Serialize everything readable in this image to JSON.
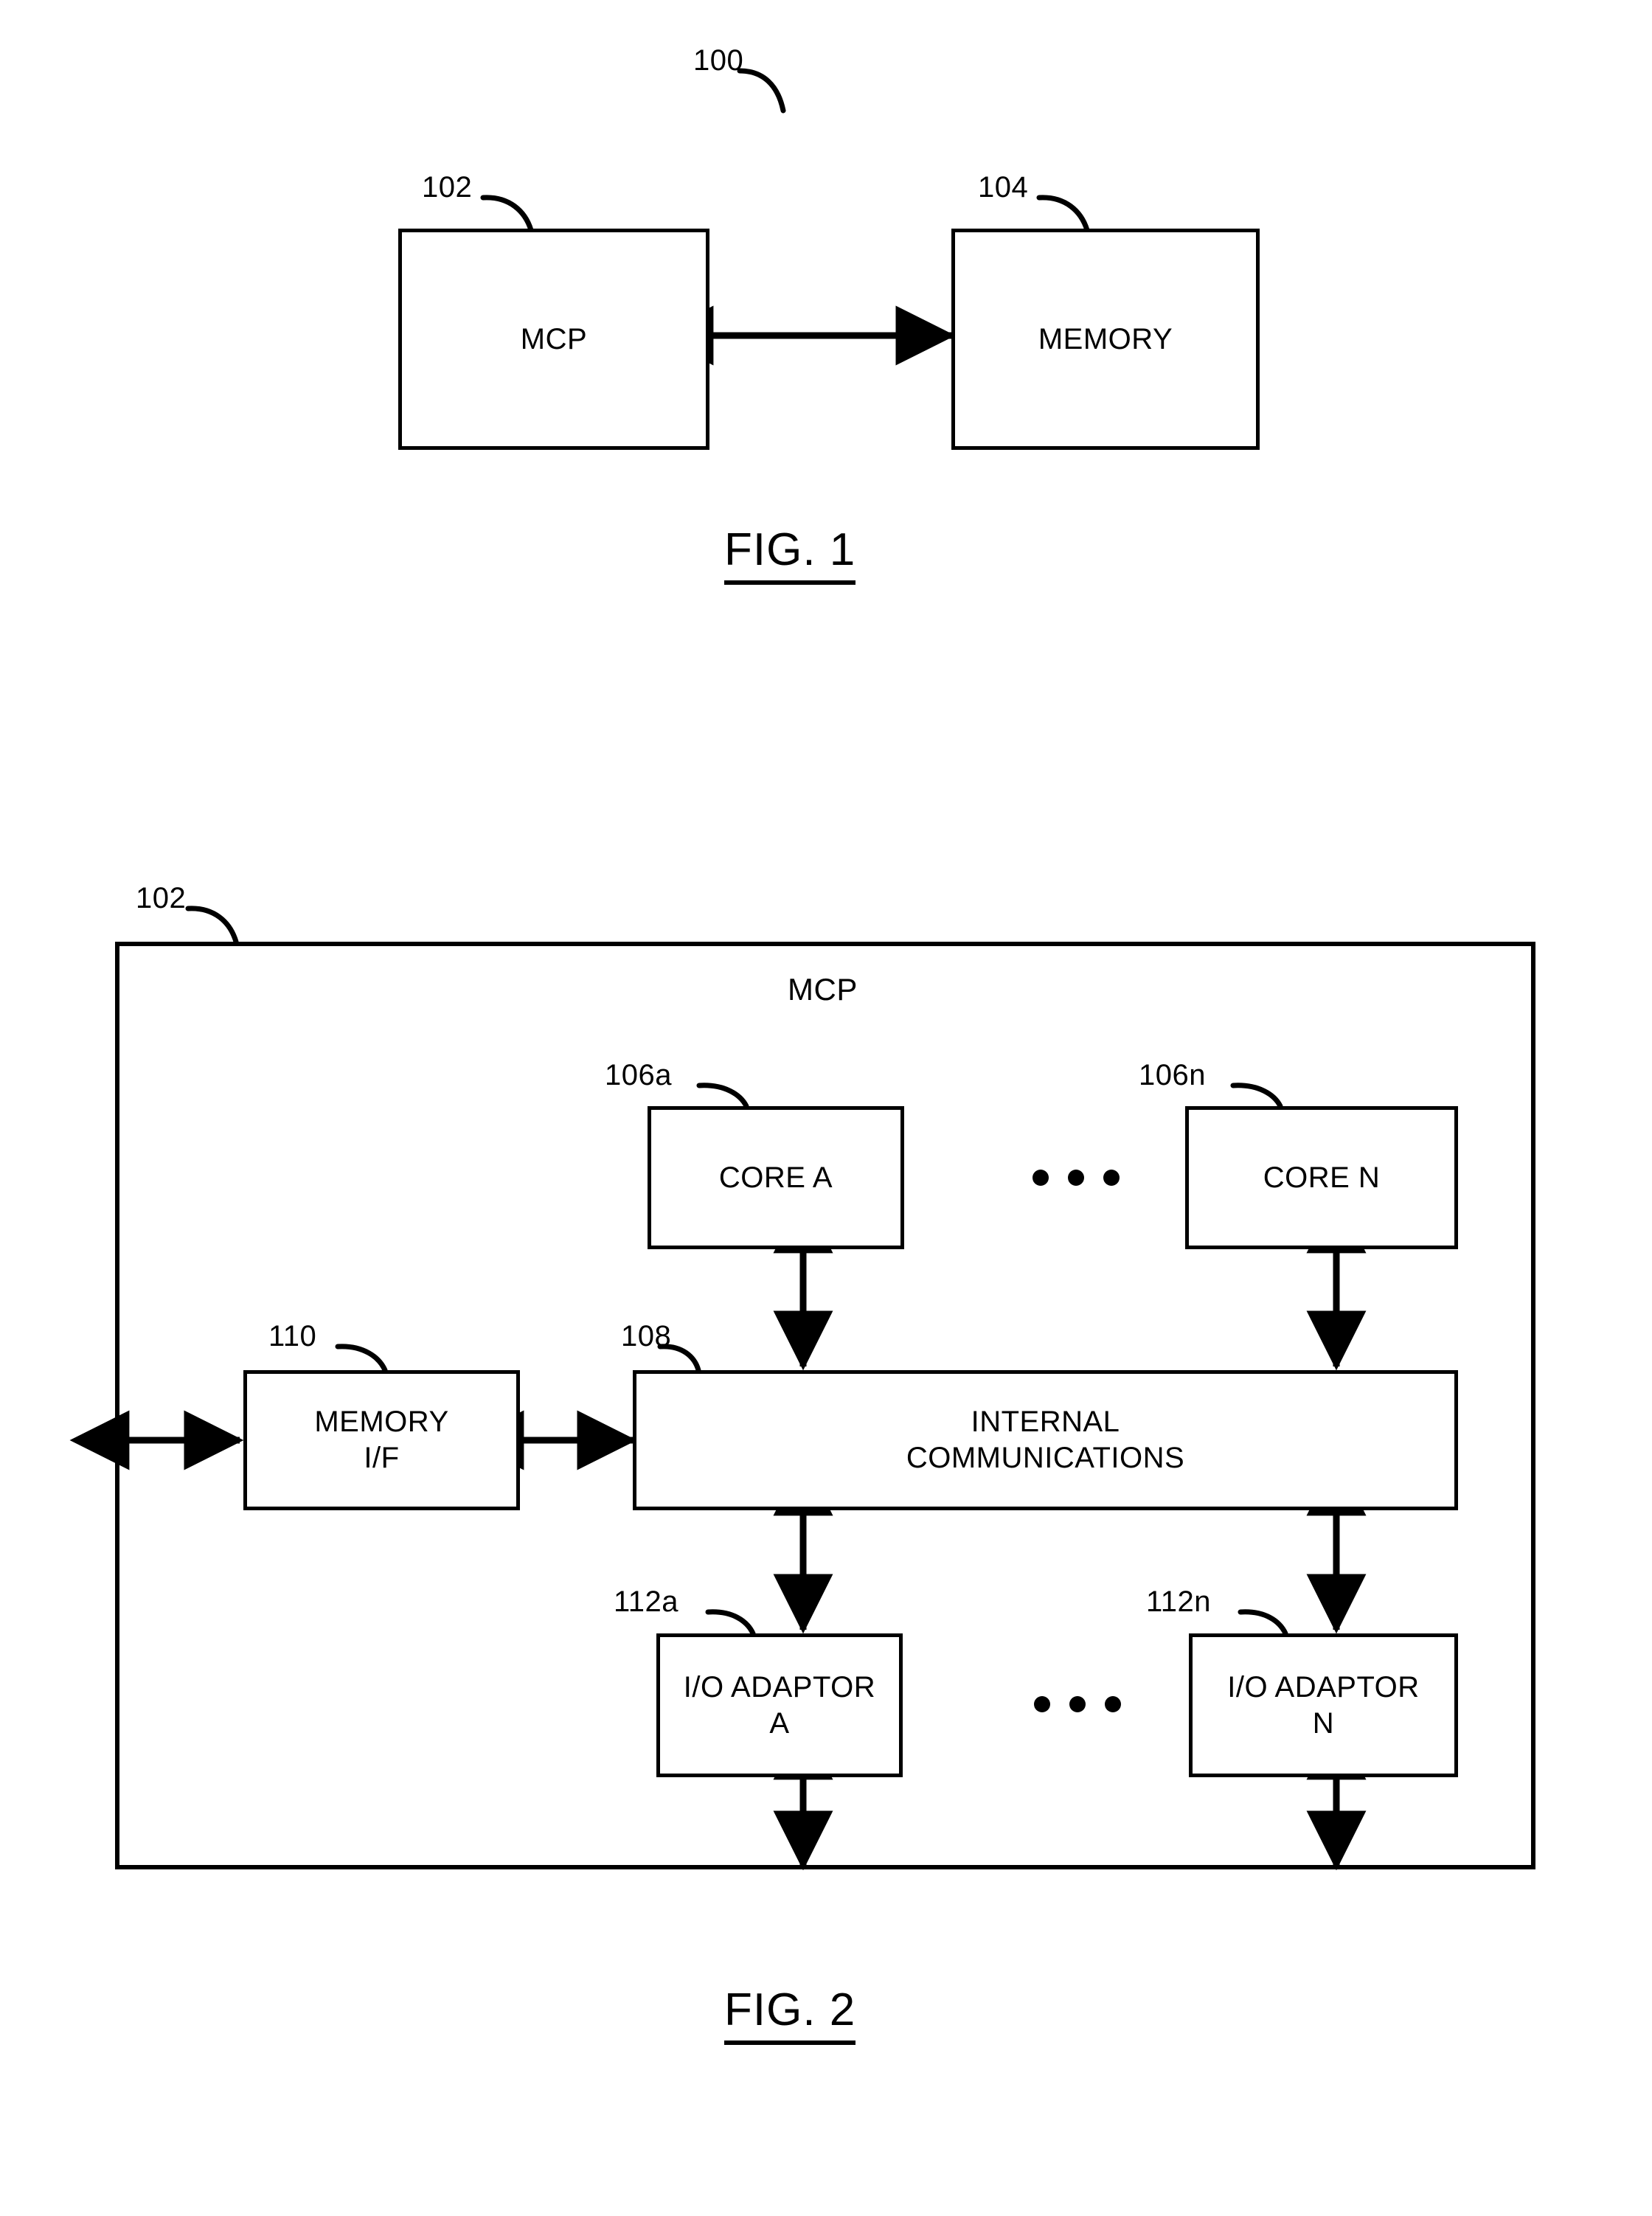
{
  "document": {
    "type": "patent-figure-sheet",
    "figures": [
      {
        "id": "fig1",
        "caption": "FIG. 1",
        "reference_numerals": [
          {
            "label": "100",
            "target": "system"
          },
          {
            "label": "102",
            "target": "mcp-block"
          },
          {
            "label": "104",
            "target": "memory-block"
          }
        ],
        "blocks": [
          {
            "id": "mcp",
            "label": "MCP"
          },
          {
            "id": "memory",
            "label": "MEMORY"
          }
        ],
        "connectors": [
          {
            "from": "mcp",
            "to": "memory",
            "style": "double-arrow",
            "orientation": "horizontal"
          }
        ]
      },
      {
        "id": "fig2",
        "caption": "FIG. 2",
        "container_label": "MCP",
        "reference_numerals": [
          {
            "label": "102",
            "target": "mcp-container"
          },
          {
            "label": "106a",
            "target": "core-a"
          },
          {
            "label": "106n",
            "target": "core-n"
          },
          {
            "label": "108",
            "target": "internal-communications"
          },
          {
            "label": "110",
            "target": "memory-if"
          },
          {
            "label": "112a",
            "target": "io-adaptor-a"
          },
          {
            "label": "112n",
            "target": "io-adaptor-n"
          }
        ],
        "blocks": [
          {
            "id": "core-a",
            "label": "CORE A"
          },
          {
            "id": "core-n",
            "label": "CORE N"
          },
          {
            "id": "memory-if",
            "label": "MEMORY\nI/F",
            "line1": "MEMORY",
            "line2": "I/F"
          },
          {
            "id": "internal-communications",
            "label": "INTERNAL\nCOMMUNICATIONS",
            "line1": "INTERNAL",
            "line2": "COMMUNICATIONS"
          },
          {
            "id": "io-adaptor-a",
            "label": "I/O ADAPTOR A",
            "line1": "I/O ADAPTOR",
            "line2": "A"
          },
          {
            "id": "io-adaptor-n",
            "label": "I/O ADAPTOR N",
            "line1": "I/O ADAPTOR",
            "line2": "N"
          }
        ],
        "ellipses": [
          {
            "id": "core-ellipsis",
            "dots": 3
          },
          {
            "id": "io-ellipsis",
            "dots": 3
          }
        ],
        "connectors": [
          {
            "from": "core-a",
            "to": "internal-communications",
            "style": "double-arrow",
            "orientation": "vertical"
          },
          {
            "from": "core-n",
            "to": "internal-communications",
            "style": "double-arrow",
            "orientation": "vertical"
          },
          {
            "from": "memory-if",
            "to": "internal-communications",
            "style": "double-arrow",
            "orientation": "horizontal"
          },
          {
            "from": "mcp-container-edge",
            "to": "memory-if",
            "style": "double-arrow",
            "orientation": "horizontal"
          },
          {
            "from": "internal-communications",
            "to": "io-adaptor-a",
            "style": "double-arrow",
            "orientation": "vertical"
          },
          {
            "from": "internal-communications",
            "to": "io-adaptor-n",
            "style": "double-arrow",
            "orientation": "vertical"
          },
          {
            "from": "io-adaptor-a",
            "to": "mcp-container-bottom",
            "style": "double-arrow",
            "orientation": "vertical"
          },
          {
            "from": "io-adaptor-n",
            "to": "mcp-container-bottom",
            "style": "double-arrow",
            "orientation": "vertical"
          }
        ]
      }
    ]
  },
  "colors": {
    "ink": "#000000",
    "paper": "#ffffff"
  }
}
